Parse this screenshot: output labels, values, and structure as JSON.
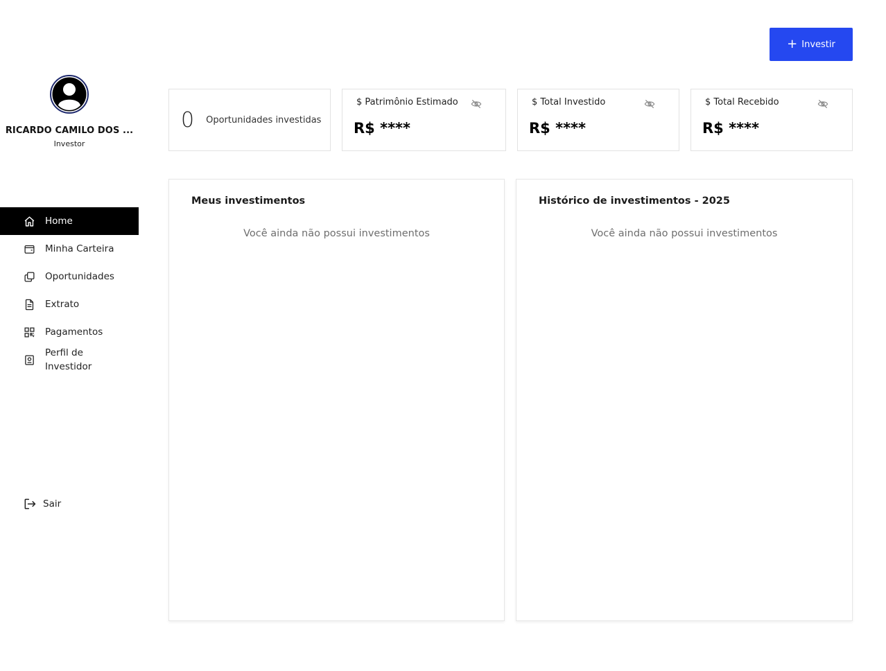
{
  "user": {
    "name": "RICARDO CAMILO DOS ...",
    "role": "Investor"
  },
  "nav": {
    "items": [
      {
        "label": "Home",
        "icon": "home-icon",
        "active": true
      },
      {
        "label": "Minha Carteira",
        "icon": "wallet-icon"
      },
      {
        "label": "Oportunidades",
        "icon": "copy-icon"
      },
      {
        "label": "Extrato",
        "icon": "document-icon"
      },
      {
        "label": "Pagamentos",
        "icon": "qr-code-icon"
      },
      {
        "label": "Perfil de Investidor",
        "icon": "profile-card-icon"
      }
    ],
    "logout": {
      "label": "Sair",
      "icon": "logout-icon"
    }
  },
  "header": {
    "invest_button": "Investir",
    "invest_icon": "plus-icon"
  },
  "stats": {
    "opportunities": {
      "count": "0",
      "label": "Oportunidades investidas"
    },
    "patrimonio": {
      "label": "$ Patrimônio Estimado",
      "value": "R$ ****"
    },
    "total_investido": {
      "label": "$ Total Investido",
      "value": "R$ ****"
    },
    "total_recebido": {
      "label": "$ Total Recebido",
      "value": "R$ ****"
    }
  },
  "panels": {
    "meus": {
      "title": "Meus investimentos",
      "empty": "Você ainda não possui investimentos"
    },
    "historico": {
      "title": "Histórico de investimentos - 2025",
      "empty": "Você ainda não possui investimentos"
    }
  },
  "colors": {
    "accent": "#2548f0",
    "active_nav": "#000000"
  }
}
